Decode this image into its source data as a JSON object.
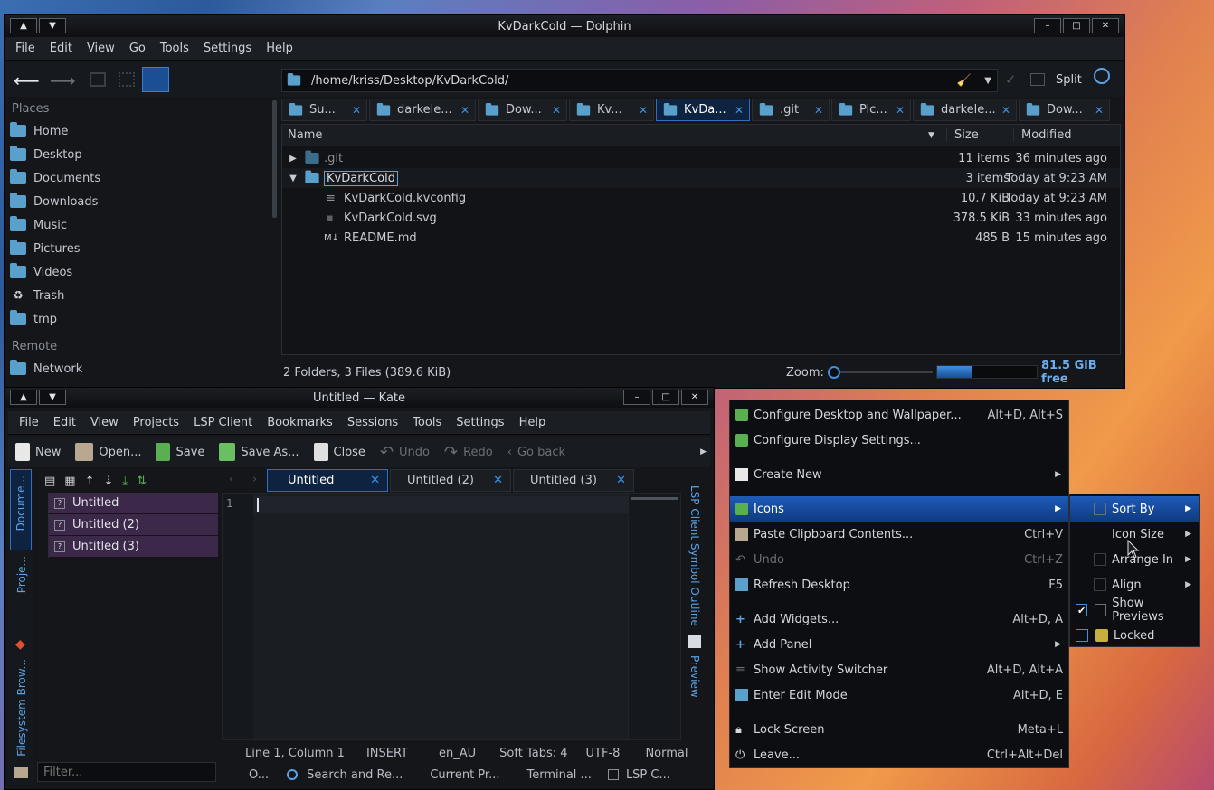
{
  "dolphin": {
    "title": "KvDarkCold — Dolphin",
    "menu": [
      "File",
      "Edit",
      "View",
      "Go",
      "Tools",
      "Settings",
      "Help"
    ],
    "path": "/home/kriss/Desktop/KvDarkCold/",
    "split_label": "Split",
    "places_header": "Places",
    "places": [
      "Home",
      "Desktop",
      "Documents",
      "Downloads",
      "Music",
      "Pictures",
      "Videos",
      "Trash",
      "tmp"
    ],
    "remote_header": "Remote",
    "remote": [
      "Network"
    ],
    "tabs": [
      "Su...",
      "darkele...",
      "Dow...",
      "Kv...",
      "KvDa...",
      ".git",
      "Pic...",
      "darkele...",
      "Dow..."
    ],
    "columns": {
      "name": "Name",
      "size": "Size",
      "modified": "Modified"
    },
    "rows": [
      {
        "name": ".git",
        "size": "11 items",
        "modified": "36 minutes ago"
      },
      {
        "name": "KvDarkCold",
        "size": "3 items",
        "modified": "Today at 9:23 AM"
      },
      {
        "name": "KvDarkCold.kvconfig",
        "size": "10.7 KiB",
        "modified": "Today at 9:23 AM"
      },
      {
        "name": "KvDarkCold.svg",
        "size": "378.5 KiB",
        "modified": "33 minutes ago"
      },
      {
        "name": "README.md",
        "size": "485 B",
        "modified": "15 minutes ago"
      }
    ],
    "status": "2 Folders, 3 Files (389.6 KiB)",
    "zoom_label": "Zoom:",
    "free": "81.5 GiB free",
    "free_fill": 0.35
  },
  "kate": {
    "title": "Untitled — Kate",
    "menu": [
      "File",
      "Edit",
      "View",
      "Projects",
      "LSP Client",
      "Bookmarks",
      "Sessions",
      "Tools",
      "Settings",
      "Help"
    ],
    "toolbar": {
      "new": "New",
      "open": "Open...",
      "save": "Save",
      "save_as": "Save As...",
      "close": "Close",
      "undo": "Undo",
      "redo": "Redo",
      "go_back": "Go back"
    },
    "tabs": [
      "Untitled",
      "Untitled (2)",
      "Untitled (3)"
    ],
    "documents": [
      "Untitled",
      "Untitled (2)",
      "Untitled (3)"
    ],
    "side_left": {
      "documents": "Docume...",
      "projects": "Proje...",
      "filesystem": "Filesystem Brow..."
    },
    "side_right": {
      "lsp": "LSP Client Symbol Outline",
      "preview": "Preview"
    },
    "line_number": "1",
    "filter_placeholder": "Filter...",
    "status": {
      "pos": "Line 1, Column 1",
      "mode": "INSERT",
      "lang": "en_AU",
      "tabs": "Soft Tabs: 4",
      "enc": "UTF-8",
      "hl": "Normal"
    },
    "bottom": {
      "o": "O...",
      "search": "Search and Re...",
      "project": "Current Pr...",
      "terminal": "Terminal ...",
      "lsp": "LSP C..."
    }
  },
  "context_menu": {
    "items": [
      {
        "label": "Configure Desktop and Wallpaper...",
        "shortcut": "Alt+D, Alt+S"
      },
      {
        "label": "Configure Display Settings...",
        "shortcut": ""
      },
      {
        "label": "Create New",
        "shortcut": ""
      },
      {
        "label": "Icons",
        "shortcut": ""
      },
      {
        "label": "Paste Clipboard Contents...",
        "shortcut": "Ctrl+V"
      },
      {
        "label": "Undo",
        "shortcut": "Ctrl+Z"
      },
      {
        "label": "Refresh Desktop",
        "shortcut": "F5"
      },
      {
        "label": "Add Widgets...",
        "shortcut": "Alt+D, A"
      },
      {
        "label": "Add Panel",
        "shortcut": ""
      },
      {
        "label": "Show Activity Switcher",
        "shortcut": "Alt+D, Alt+A"
      },
      {
        "label": "Enter Edit Mode",
        "shortcut": "Alt+D, E"
      },
      {
        "label": "Lock Screen",
        "shortcut": "Meta+L"
      },
      {
        "label": "Leave...",
        "shortcut": "Ctrl+Alt+Del"
      }
    ],
    "submenu": [
      {
        "label": "Sort By"
      },
      {
        "label": "Icon Size"
      },
      {
        "label": "Arrange In"
      },
      {
        "label": "Align"
      },
      {
        "label": "Show Previews",
        "checked": true
      },
      {
        "label": "Locked",
        "checked": false
      }
    ]
  },
  "colors": {
    "accent": "#2e6fbf",
    "highlight": "#1e5bb8",
    "doc_bg": "#3c2848"
  }
}
